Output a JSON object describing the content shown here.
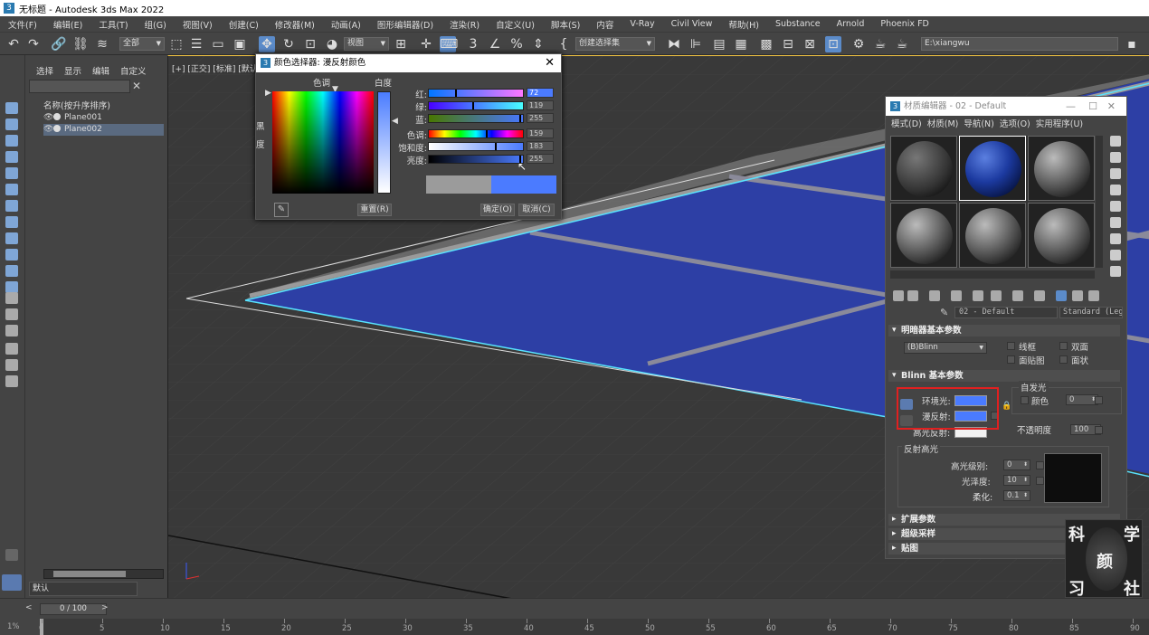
{
  "title_bar": {
    "title": "无标题 - Autodesk 3ds Max 2022"
  },
  "menu": [
    "文件(F)",
    "编辑(E)",
    "工具(T)",
    "组(G)",
    "视图(V)",
    "创建(C)",
    "修改器(M)",
    "动画(A)",
    "图形编辑器(D)",
    "渲染(R)",
    "自定义(U)",
    "脚本(S)",
    "内容",
    "V-Ray",
    "Civil View",
    "帮助(H)",
    "Substance",
    "Arnold",
    "Phoenix FD"
  ],
  "toolbar": {
    "selection_filter": "全部",
    "ref_coord": "视图",
    "named_selection": "创建选择集",
    "path_field": "E:\\xiangwu"
  },
  "explorer": {
    "tabs": [
      "选择",
      "显示",
      "编辑",
      "自定义"
    ],
    "header": "名称(按升序排序)",
    "rows": [
      {
        "name": "Plane001",
        "selected": false
      },
      {
        "name": "Plane002",
        "selected": true
      }
    ],
    "layer": "默认"
  },
  "viewport": {
    "label": "[+] [正交] [标准] [默认"
  },
  "color_picker": {
    "title": "颜色选择器: 漫反射颜色",
    "hue_label": "色调",
    "whiteness_label": "白度",
    "blackness_label": "黑",
    "blackness_label2": "度",
    "channels": [
      {
        "label": "红:",
        "value": "72"
      },
      {
        "label": "绿:",
        "value": "119"
      },
      {
        "label": "蓝:",
        "value": "255"
      },
      {
        "label": "色调:",
        "value": "159"
      },
      {
        "label": "饱和度:",
        "value": "183"
      },
      {
        "label": "亮度:",
        "value": "255"
      }
    ],
    "channel_fractions": [
      0.28,
      0.47,
      1.0,
      0.62,
      0.72,
      1.0
    ],
    "reset_button": "重置(R)",
    "ok_button": "确定(O)",
    "cancel_button": "取消(C)",
    "old_color": "#9b9b9b",
    "new_color": "#4b7bff"
  },
  "material_editor": {
    "title": "材质编辑器 - 02 - Default",
    "menu": [
      "模式(D)",
      "材质(M)",
      "导航(N)",
      "选项(O)",
      "实用程序(U)"
    ],
    "material_name": "02 - Default",
    "material_type": "Standard (Legacy)",
    "shader_rollout": "明暗器基本参数",
    "shader": "(B)Blinn",
    "shader_opts": [
      "线框",
      "双面",
      "面贴图",
      "面状"
    ],
    "blinn_rollout": "Blinn 基本参数",
    "self_illum": {
      "group": "自发光",
      "color_label": "颜色",
      "value": "0"
    },
    "ambient_label": "环境光:",
    "diffuse_label": "漫反射:",
    "specular_label": "高光反射:",
    "ambient_color": "#4a7bff",
    "diffuse_color": "#4a7bff",
    "specular_color": "#f2f2f2",
    "opacity": {
      "label": "不透明度",
      "value": "100"
    },
    "spec_group": "反射高光",
    "spec_level": {
      "label": "高光级别:",
      "value": "0"
    },
    "glossiness": {
      "label": "光泽度:",
      "value": "10"
    },
    "soften": {
      "label": "柔化:",
      "value": "0.1"
    },
    "rollouts_closed": [
      "扩展参数",
      "超级采样",
      "贴图"
    ]
  },
  "watermark": {
    "chars": [
      "科",
      "学",
      "颜",
      "习",
      "社"
    ]
  },
  "timeline": {
    "frame": "0 / 100",
    "ticks": [
      "0",
      "5",
      "10",
      "15",
      "20",
      "25",
      "30",
      "35",
      "40",
      "45",
      "50",
      "55",
      "60",
      "65",
      "70",
      "75",
      "80",
      "85",
      "90"
    ],
    "status": "1%"
  }
}
